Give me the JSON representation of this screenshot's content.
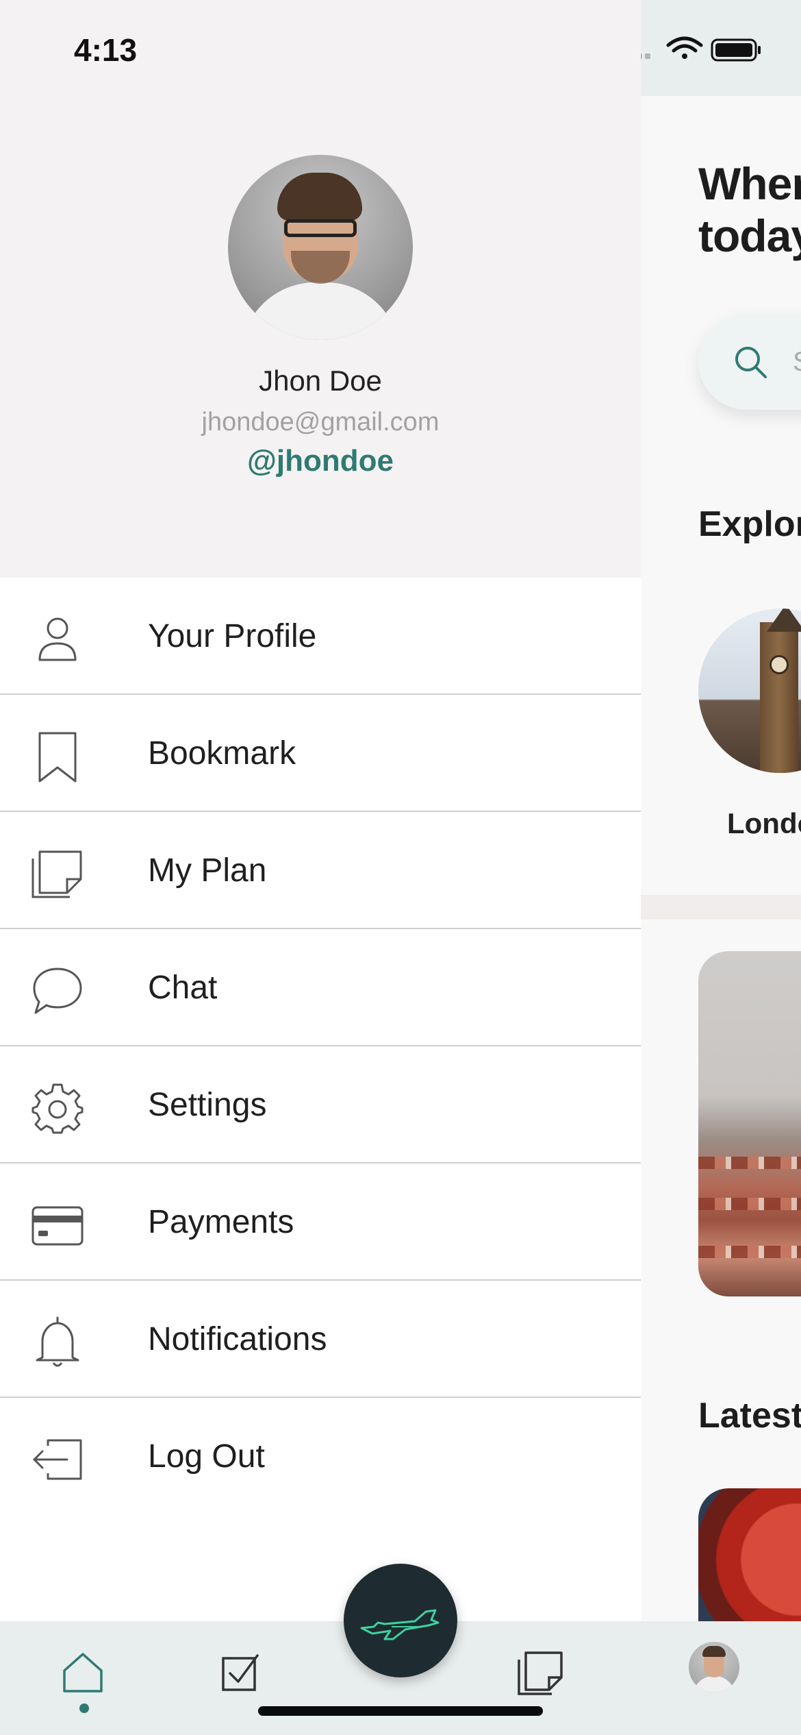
{
  "status_bar": {
    "time": "4:13"
  },
  "main_screen": {
    "headline": "Wher\ntoday",
    "search_placeholder": "S",
    "explore_title": "Explor",
    "explore_city": "Londo",
    "latest_title": "Latest"
  },
  "drawer": {
    "user": {
      "name": "Jhon Doe",
      "email": "jhondoe@gmail.com",
      "handle": "@jhondoe"
    },
    "menu": [
      {
        "label": "Your Profile",
        "icon": "user-icon"
      },
      {
        "label": "Bookmark",
        "icon": "bookmark-icon"
      },
      {
        "label": "My Plan",
        "icon": "plan-note-icon"
      },
      {
        "label": "Chat",
        "icon": "chat-bubble-icon"
      },
      {
        "label": "Settings",
        "icon": "gear-icon"
      },
      {
        "label": "Payments",
        "icon": "credit-card-icon"
      },
      {
        "label": "Notifications",
        "icon": "bell-icon"
      },
      {
        "label": "Log Out",
        "icon": "logout-icon"
      }
    ]
  },
  "tab_bar": {
    "tabs": [
      {
        "name": "home",
        "icon": "home-icon",
        "active": true
      },
      {
        "name": "tasks",
        "icon": "checkbox-icon",
        "active": false
      },
      {
        "name": "fab",
        "icon": "airplane-icon",
        "active": false
      },
      {
        "name": "plans",
        "icon": "notes-icon",
        "active": false
      },
      {
        "name": "profile",
        "icon": "avatar",
        "active": false
      }
    ]
  },
  "colors": {
    "accent": "#2f7a73",
    "drawer_header_bg": "#f4f2f2",
    "tab_bar_bg": "#e8eded",
    "fab_bg": "#1e2b30",
    "fab_icon": "#3fd1a0"
  }
}
